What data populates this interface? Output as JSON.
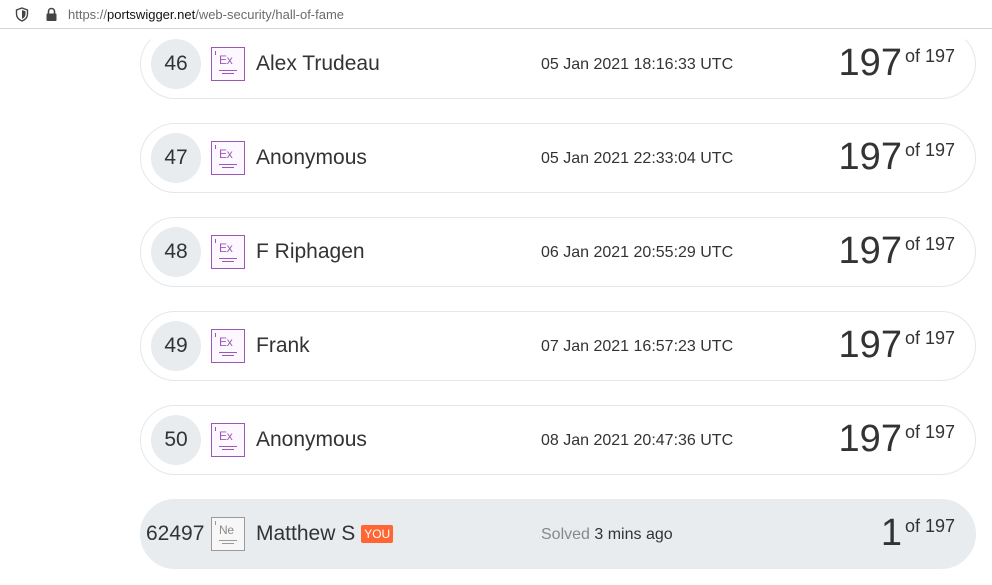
{
  "browser": {
    "url_prefix": "https://",
    "url_host": "portswigger.net",
    "url_path": "/web-security/hall-of-fame"
  },
  "hall_of_fame": {
    "rows": [
      {
        "rank": "46",
        "level": "Ex",
        "name": "Alex Trudeau",
        "date": "05 Jan 2021 18:16:33 UTC",
        "score": "197",
        "of": "of 197"
      },
      {
        "rank": "47",
        "level": "Ex",
        "name": "Anonymous",
        "date": "05 Jan 2021 22:33:04 UTC",
        "score": "197",
        "of": "of 197"
      },
      {
        "rank": "48",
        "level": "Ex",
        "name": "F Riphagen",
        "date": "06 Jan 2021 20:55:29 UTC",
        "score": "197",
        "of": "of 197"
      },
      {
        "rank": "49",
        "level": "Ex",
        "name": "Frank",
        "date": "07 Jan 2021 16:57:23 UTC",
        "score": "197",
        "of": "of 197"
      },
      {
        "rank": "50",
        "level": "Ex",
        "name": "Anonymous",
        "date": "08 Jan 2021 20:47:36 UTC",
        "score": "197",
        "of": "of 197"
      }
    ],
    "current_user": {
      "rank": "62497",
      "level": "Ne",
      "name": "Matthew S",
      "badge": "YOU",
      "solved_label": "Solved",
      "solved_time": "3 mins ago",
      "score": "1",
      "of": "of 197"
    }
  },
  "colors": {
    "expert_accent": "#9b59b6",
    "you_badge": "#ff6633",
    "row_highlight": "#e8ecef"
  }
}
